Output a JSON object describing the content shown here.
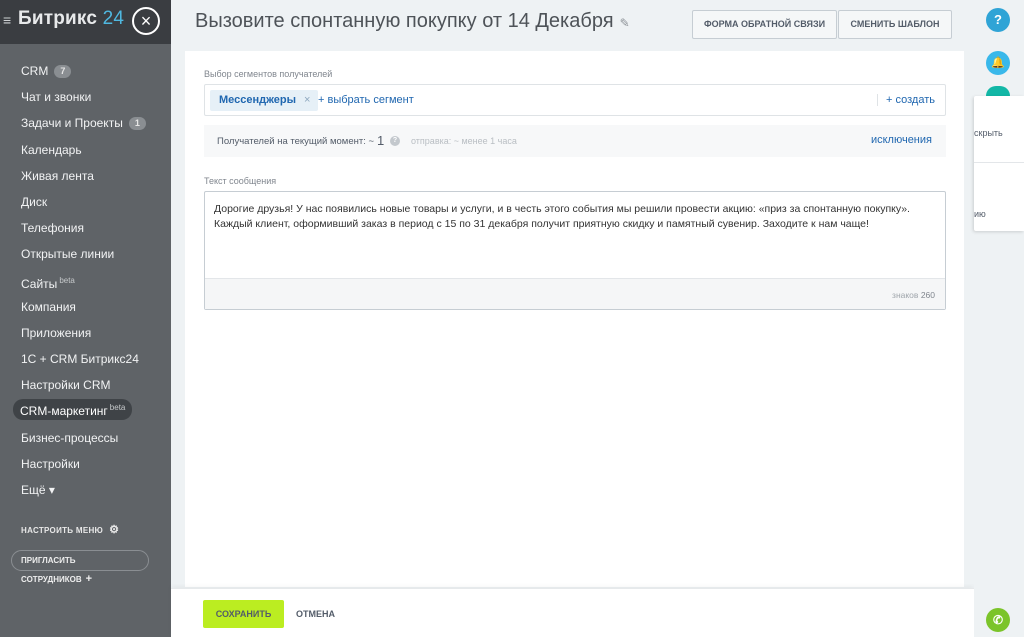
{
  "sidebar": {
    "logo_text": "Битрикс",
    "logo_number": "24",
    "close_icon": "×",
    "items": [
      {
        "label": "CRM",
        "badge": "7"
      },
      {
        "label": "Чат и звонки"
      },
      {
        "label": "Задачи и Проекты",
        "badge": "1"
      },
      {
        "label": "Календарь"
      },
      {
        "label": "Живая лента"
      },
      {
        "label": "Диск"
      },
      {
        "label": "Телефония"
      },
      {
        "label": "Открытые линии"
      },
      {
        "label": "Сайты",
        "sup": "beta"
      },
      {
        "label": "Компания"
      },
      {
        "label": "Приложения"
      },
      {
        "label": "1С + CRM Битрикс24"
      },
      {
        "label": "Настройки CRM"
      },
      {
        "label": "CRM-маркетинг",
        "sup": "beta",
        "active": true
      },
      {
        "label": "Бизнес-процессы"
      },
      {
        "label": "Настройки"
      },
      {
        "label": "Ещё ▾"
      }
    ],
    "settings_menu": "НАСТРОИТЬ МЕНЮ",
    "invite_button": "ПРИГЛАСИТЬ СОТРУДНИКОВ"
  },
  "header": {
    "title": "Вызовите спонтанную покупку от 14 Декабря",
    "feedback_button": "ФОРМА ОБРАТНОЙ СВЯЗИ",
    "change_template_button": "СМЕНИТЬ ШАБЛОН"
  },
  "segments": {
    "label": "Выбор сегментов получателей",
    "selected_tag": "Мессенджеры",
    "select_segment_link": "+ выбрать сегмент",
    "create_link": "+ создать"
  },
  "recipients": {
    "label": "Получателей на текущий момент: ~",
    "count": "1",
    "send_info": "отправка: ~ менее 1 часа",
    "exceptions_link": "исключения"
  },
  "message": {
    "label": "Текст сообщения",
    "line1": "Дорогие друзья! У нас появились новые товары и услуги, и в честь этого события мы решили провести акцию: «приз за спонтанную покупку».",
    "line2": "Каждый клиент, оформивший заказ в период с 15 по 31 декабря получит приятную скидку и памятный сувенир. Заходите к нам чаще!",
    "char_label": "знаков",
    "char_count": "260"
  },
  "actions": {
    "save_button": "СОХРАНИТЬ",
    "cancel_button": "ОТМЕНА"
  },
  "right_rail": {
    "help_icon": "?",
    "popup_text_1": "скрыть",
    "popup_text_2": "ию"
  }
}
